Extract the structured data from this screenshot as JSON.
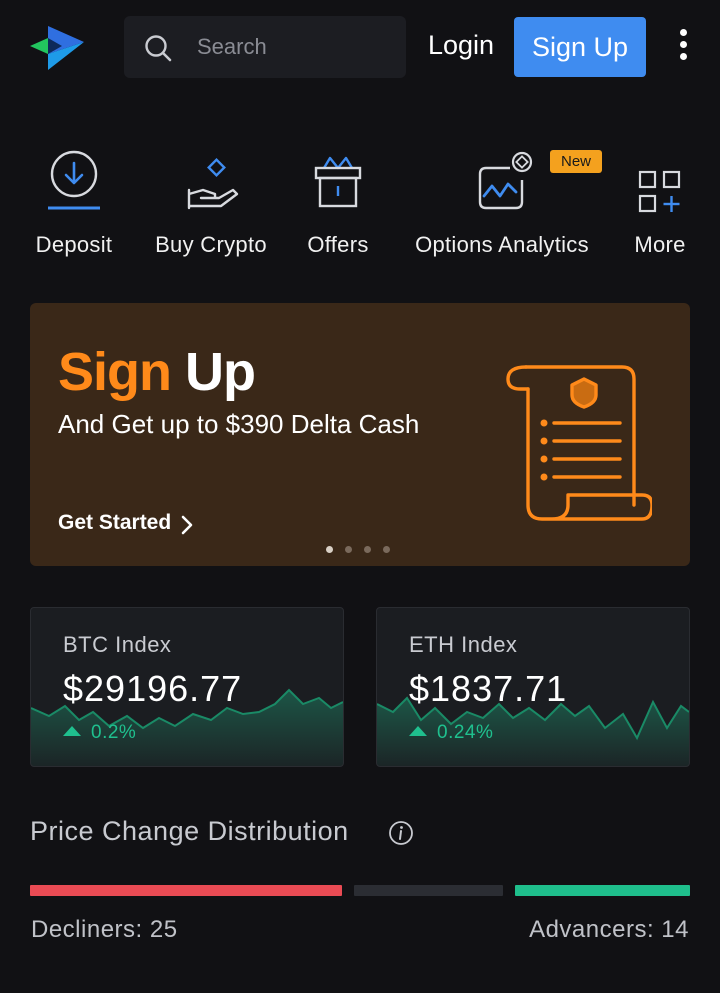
{
  "header": {
    "search_placeholder": "Search",
    "login_label": "Login",
    "signup_label": "Sign Up"
  },
  "quick_actions": [
    {
      "label": "Deposit",
      "icon": "deposit-icon"
    },
    {
      "label": "Buy Crypto",
      "icon": "buy-crypto-icon"
    },
    {
      "label": "Offers",
      "icon": "gift-icon"
    },
    {
      "label": "Options Analytics",
      "icon": "analytics-icon",
      "badge": "New"
    },
    {
      "label": "More",
      "icon": "grid-plus-icon"
    }
  ],
  "banner": {
    "title_highlight": "Sign",
    "title_rest": "Up",
    "subtitle": "And Get up to $390 Delta Cash",
    "cta": "Get Started",
    "slide_count": 4,
    "active_slide": 1
  },
  "indices": [
    {
      "name": "BTC Index",
      "value": "$29196.77",
      "change": "0.2%"
    },
    {
      "name": "ETH Index",
      "value": "$1837.71",
      "change": "0.24%"
    }
  ],
  "price_distribution": {
    "title": "Price Change Distribution",
    "decliners_label": "Decliners: 25",
    "advancers_label": "Advancers: 14"
  },
  "colors": {
    "background": "#111114",
    "primary_button": "#3f8cf0",
    "accent_orange": "#ff8a1a",
    "positive": "#1fbf8c",
    "negative": "#ea4b54",
    "badge": "#f4a11e"
  }
}
